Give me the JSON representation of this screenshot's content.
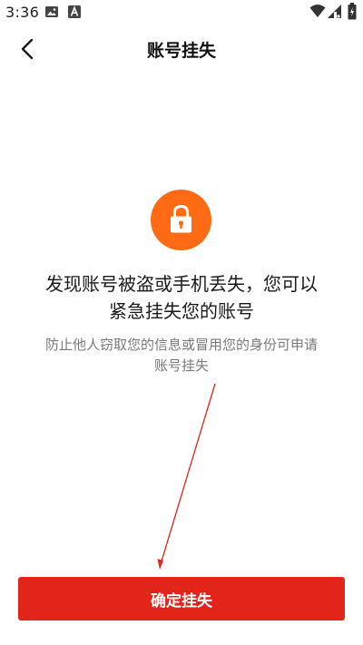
{
  "status_bar": {
    "time": "3:36",
    "icons": [
      "image-icon",
      "app-a-icon",
      "wifi-icon",
      "signal-icon",
      "battery-icon"
    ]
  },
  "header": {
    "title": "账号挂失",
    "back_icon": "chevron-left-icon"
  },
  "main": {
    "icon": "lock-icon",
    "icon_color": "#ff6a14",
    "headline_line1": "发现账号被盗或手机丢失，您可以",
    "headline_line2": "紧急挂失您的账号",
    "subtext_line1": "防止他人窃取您的信息或冒用您的身份可申请",
    "subtext_line2": "账号挂失"
  },
  "footer": {
    "confirm_label": "确定挂失",
    "confirm_color": "#e3241b"
  }
}
